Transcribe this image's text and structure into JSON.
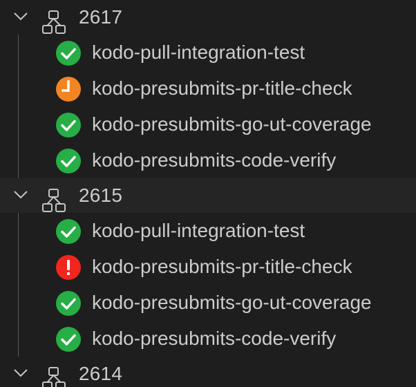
{
  "groups": [
    {
      "id": "2617",
      "expanded": true,
      "jobs": [
        {
          "name": "kodo-pull-integration-test",
          "status": "success"
        },
        {
          "name": "kodo-presubmits-pr-title-check",
          "status": "pending"
        },
        {
          "name": "kodo-presubmits-go-ut-coverage",
          "status": "success"
        },
        {
          "name": "kodo-presubmits-code-verify",
          "status": "success"
        }
      ]
    },
    {
      "id": "2615",
      "expanded": true,
      "jobs": [
        {
          "name": "kodo-pull-integration-test",
          "status": "success"
        },
        {
          "name": "kodo-presubmits-pr-title-check",
          "status": "failure"
        },
        {
          "name": "kodo-presubmits-go-ut-coverage",
          "status": "success"
        },
        {
          "name": "kodo-presubmits-code-verify",
          "status": "success"
        }
      ]
    },
    {
      "id": "2614",
      "expanded": true,
      "jobs": []
    }
  ],
  "colors": {
    "success": "#27ae46",
    "pending": "#f28522",
    "failure": "#f2251f",
    "text": "#cccccc",
    "guide": "#585858"
  },
  "icons": {
    "chevron": "chevron-down-icon",
    "group": "pipeline-graph-icon",
    "success": "check-circle-icon",
    "pending": "clock-circle-icon",
    "failure": "error-circle-icon"
  }
}
